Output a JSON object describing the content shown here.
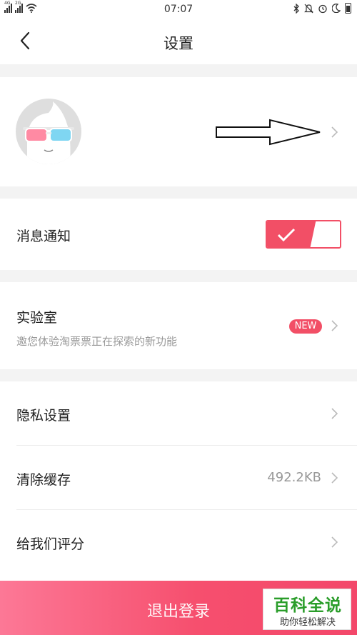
{
  "status_bar": {
    "time": "07:07",
    "sim1_label": "4G",
    "sim2_label": "2G",
    "icons": [
      "bluetooth-icon",
      "mute-icon",
      "alarm-icon",
      "moon-icon",
      "battery-icon"
    ]
  },
  "nav": {
    "title": "设置",
    "back_icon": "chevron-left-icon"
  },
  "profile": {
    "avatar": "avatar-ghost-3d-glasses"
  },
  "notifications": {
    "label": "消息通知",
    "enabled": true
  },
  "lab": {
    "label": "实验室",
    "subtitle": "邀您体验淘票票正在探索的新功能",
    "badge": "NEW"
  },
  "settings_list": {
    "privacy": "隐私设置",
    "clear_cache": "清除缓存",
    "cache_size": "492.2KB",
    "rate_us": "给我们评分"
  },
  "logout": {
    "label": "退出登录"
  },
  "watermark": {
    "line1": "百科全说",
    "line2": "助你轻松解决"
  },
  "colors": {
    "accent": "#f24f66",
    "background": "#f3f3f3",
    "watermark_green": "#2a9d2a"
  }
}
